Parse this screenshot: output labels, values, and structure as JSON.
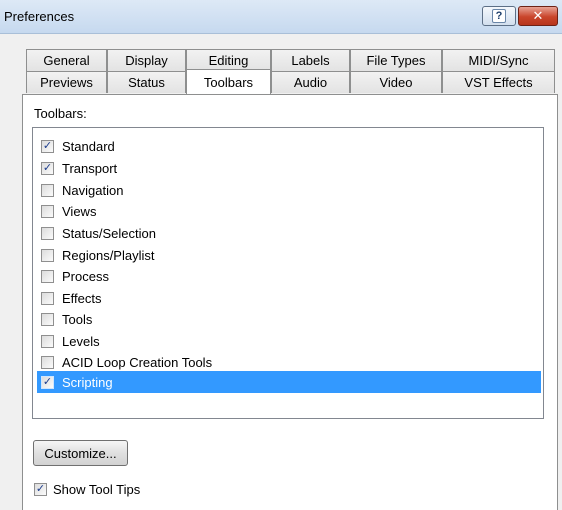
{
  "window": {
    "title": "Preferences",
    "help_label": "?",
    "close_label": "✕"
  },
  "tabs_row1": [
    "General",
    "Display",
    "Editing",
    "Labels",
    "File Types",
    "MIDI/Sync"
  ],
  "tabs_row2": [
    "Previews",
    "Status",
    "Toolbars",
    "Audio",
    "Video",
    "VST Effects"
  ],
  "active_tab": "Toolbars",
  "toolbars_label": "Toolbars:",
  "toolbar_items": [
    {
      "label": "Standard",
      "checked": true,
      "selected": false
    },
    {
      "label": "Transport",
      "checked": true,
      "selected": false
    },
    {
      "label": "Navigation",
      "checked": false,
      "selected": false
    },
    {
      "label": "Views",
      "checked": false,
      "selected": false
    },
    {
      "label": "Status/Selection",
      "checked": false,
      "selected": false
    },
    {
      "label": "Regions/Playlist",
      "checked": false,
      "selected": false
    },
    {
      "label": "Process",
      "checked": false,
      "selected": false
    },
    {
      "label": "Effects",
      "checked": false,
      "selected": false
    },
    {
      "label": "Tools",
      "checked": false,
      "selected": false
    },
    {
      "label": "Levels",
      "checked": false,
      "selected": false
    },
    {
      "label": "ACID Loop Creation Tools",
      "checked": false,
      "selected": false
    },
    {
      "label": "Scripting",
      "checked": true,
      "selected": true
    }
  ],
  "customize_label": "Customize...",
  "show_tooltips": {
    "label": "Show Tool Tips",
    "checked": true
  },
  "colors": {
    "selection": "#3399ff",
    "titlebar": "#c6d9ef",
    "close_button": "#c9452b"
  }
}
